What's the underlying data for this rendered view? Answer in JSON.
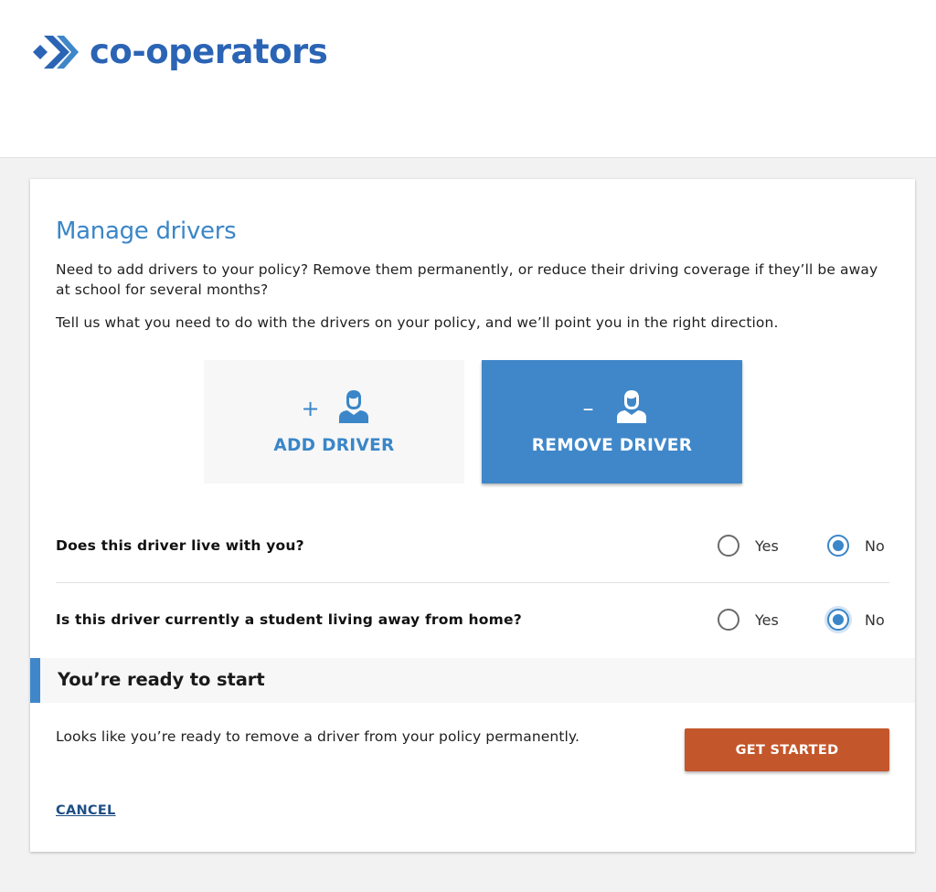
{
  "brand": {
    "name": "co-operators",
    "logo_icon": "double-chevron-logo-icon",
    "color": "#2b64b5"
  },
  "page": {
    "title": "Manage drivers",
    "description1": "Need to add drivers to your policy? Remove them permanently, or reduce their driving coverage if they’ll be away at school for several months?",
    "description2": "Tell us what you need to do with the drivers on your policy, and we’ll point you in the right direction."
  },
  "choices": {
    "add": {
      "label": "ADD DRIVER",
      "sign": "+",
      "icon": "person-icon",
      "selected": false
    },
    "remove": {
      "label": "REMOVE DRIVER",
      "sign": "–",
      "icon": "person-icon",
      "selected": true
    }
  },
  "questions": [
    {
      "text": "Does this driver live with you?",
      "yes_label": "Yes",
      "no_label": "No",
      "selected": "No"
    },
    {
      "text": "Is this driver currently a student living away from home?",
      "yes_label": "Yes",
      "no_label": "No",
      "selected": "No"
    }
  ],
  "ready": {
    "title": "You’re ready to start",
    "message": "Looks like you’re ready to remove a driver from your policy permanently.",
    "button_label": "GET STARTED"
  },
  "cancel_label": "CANCEL",
  "colors": {
    "accent": "#3a86c8",
    "primary_button": "#c4562b",
    "link": "#1e4f86"
  }
}
